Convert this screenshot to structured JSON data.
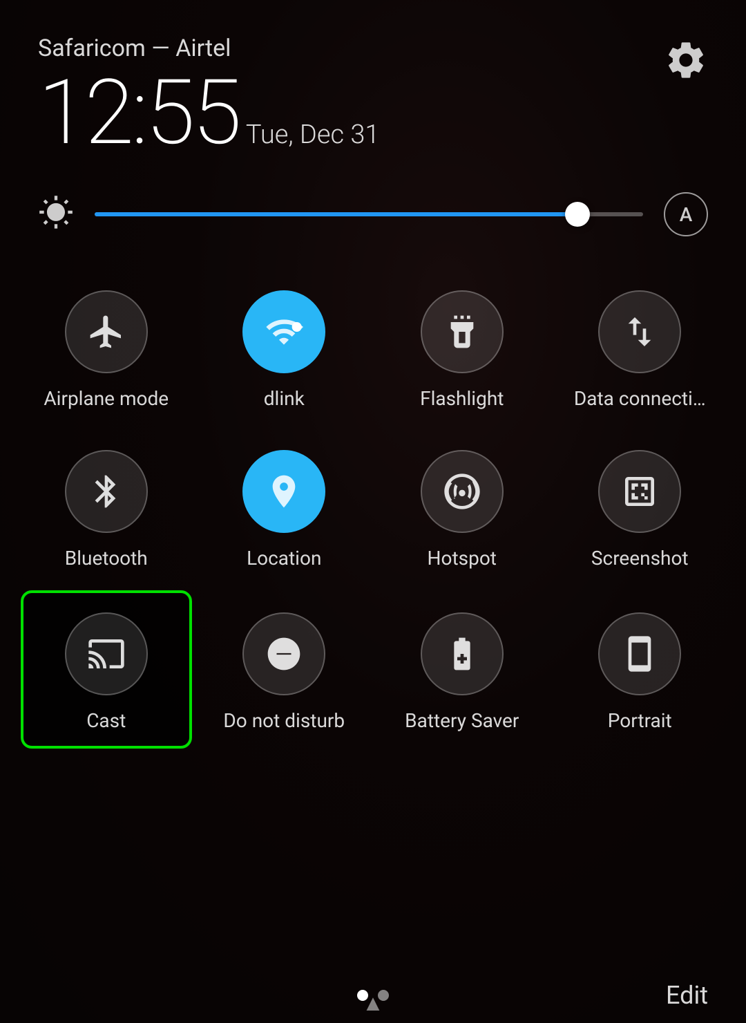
{
  "header": {
    "carrier": "Safaricom — Airtel",
    "time": "12:55",
    "date": "Tue, Dec 31"
  },
  "brightness": {
    "value": 88,
    "auto_label": "A"
  },
  "tiles_row1": [
    {
      "id": "airplane-mode",
      "label": "Airplane mode",
      "active": false
    },
    {
      "id": "wifi",
      "label": "dlink",
      "active": true
    },
    {
      "id": "flashlight",
      "label": "Flashlight",
      "active": false
    },
    {
      "id": "data-connection",
      "label": "Data connecti…",
      "active": false
    }
  ],
  "tiles_row2": [
    {
      "id": "bluetooth",
      "label": "Bluetooth",
      "active": false
    },
    {
      "id": "location",
      "label": "Location",
      "active": true
    },
    {
      "id": "hotspot",
      "label": "Hotspot",
      "active": false
    },
    {
      "id": "screenshot",
      "label": "Screenshot",
      "active": false
    }
  ],
  "tiles_row3": [
    {
      "id": "cast",
      "label": "Cast",
      "active": false,
      "highlighted": true
    },
    {
      "id": "do-not-disturb",
      "label": "Do not disturb",
      "active": false
    },
    {
      "id": "battery-saver",
      "label": "Battery Saver",
      "active": false
    },
    {
      "id": "portrait",
      "label": "Portrait",
      "active": false
    }
  ],
  "bottom": {
    "edit_label": "Edit",
    "dots": [
      true,
      false
    ]
  }
}
